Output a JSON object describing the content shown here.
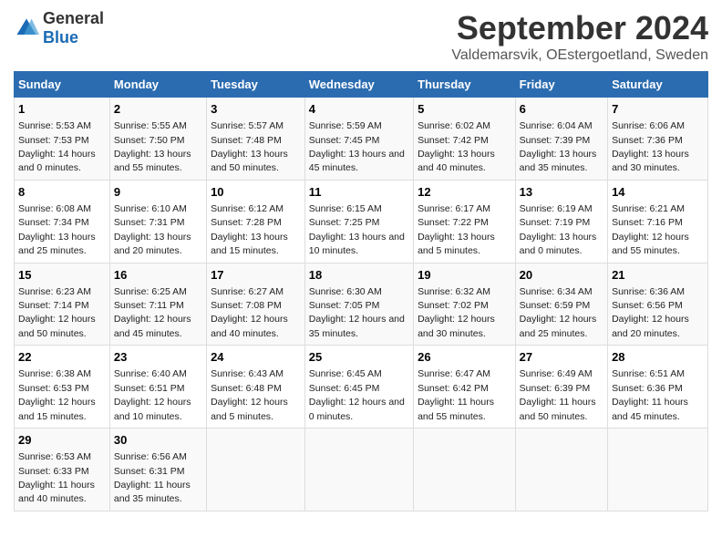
{
  "logo": {
    "general": "General",
    "blue": "Blue"
  },
  "title": "September 2024",
  "subtitle": "Valdemarsvik, OEstergoetland, Sweden",
  "days_header": [
    "Sunday",
    "Monday",
    "Tuesday",
    "Wednesday",
    "Thursday",
    "Friday",
    "Saturday"
  ],
  "weeks": [
    [
      {
        "day": "1",
        "sunrise": "5:53 AM",
        "sunset": "7:53 PM",
        "daylight": "14 hours and 0 minutes."
      },
      {
        "day": "2",
        "sunrise": "5:55 AM",
        "sunset": "7:50 PM",
        "daylight": "13 hours and 55 minutes."
      },
      {
        "day": "3",
        "sunrise": "5:57 AM",
        "sunset": "7:48 PM",
        "daylight": "13 hours and 50 minutes."
      },
      {
        "day": "4",
        "sunrise": "5:59 AM",
        "sunset": "7:45 PM",
        "daylight": "13 hours and 45 minutes."
      },
      {
        "day": "5",
        "sunrise": "6:02 AM",
        "sunset": "7:42 PM",
        "daylight": "13 hours and 40 minutes."
      },
      {
        "day": "6",
        "sunrise": "6:04 AM",
        "sunset": "7:39 PM",
        "daylight": "13 hours and 35 minutes."
      },
      {
        "day": "7",
        "sunrise": "6:06 AM",
        "sunset": "7:36 PM",
        "daylight": "13 hours and 30 minutes."
      }
    ],
    [
      {
        "day": "8",
        "sunrise": "6:08 AM",
        "sunset": "7:34 PM",
        "daylight": "13 hours and 25 minutes."
      },
      {
        "day": "9",
        "sunrise": "6:10 AM",
        "sunset": "7:31 PM",
        "daylight": "13 hours and 20 minutes."
      },
      {
        "day": "10",
        "sunrise": "6:12 AM",
        "sunset": "7:28 PM",
        "daylight": "13 hours and 15 minutes."
      },
      {
        "day": "11",
        "sunrise": "6:15 AM",
        "sunset": "7:25 PM",
        "daylight": "13 hours and 10 minutes."
      },
      {
        "day": "12",
        "sunrise": "6:17 AM",
        "sunset": "7:22 PM",
        "daylight": "13 hours and 5 minutes."
      },
      {
        "day": "13",
        "sunrise": "6:19 AM",
        "sunset": "7:19 PM",
        "daylight": "13 hours and 0 minutes."
      },
      {
        "day": "14",
        "sunrise": "6:21 AM",
        "sunset": "7:16 PM",
        "daylight": "12 hours and 55 minutes."
      }
    ],
    [
      {
        "day": "15",
        "sunrise": "6:23 AM",
        "sunset": "7:14 PM",
        "daylight": "12 hours and 50 minutes."
      },
      {
        "day": "16",
        "sunrise": "6:25 AM",
        "sunset": "7:11 PM",
        "daylight": "12 hours and 45 minutes."
      },
      {
        "day": "17",
        "sunrise": "6:27 AM",
        "sunset": "7:08 PM",
        "daylight": "12 hours and 40 minutes."
      },
      {
        "day": "18",
        "sunrise": "6:30 AM",
        "sunset": "7:05 PM",
        "daylight": "12 hours and 35 minutes."
      },
      {
        "day": "19",
        "sunrise": "6:32 AM",
        "sunset": "7:02 PM",
        "daylight": "12 hours and 30 minutes."
      },
      {
        "day": "20",
        "sunrise": "6:34 AM",
        "sunset": "6:59 PM",
        "daylight": "12 hours and 25 minutes."
      },
      {
        "day": "21",
        "sunrise": "6:36 AM",
        "sunset": "6:56 PM",
        "daylight": "12 hours and 20 minutes."
      }
    ],
    [
      {
        "day": "22",
        "sunrise": "6:38 AM",
        "sunset": "6:53 PM",
        "daylight": "12 hours and 15 minutes."
      },
      {
        "day": "23",
        "sunrise": "6:40 AM",
        "sunset": "6:51 PM",
        "daylight": "12 hours and 10 minutes."
      },
      {
        "day": "24",
        "sunrise": "6:43 AM",
        "sunset": "6:48 PM",
        "daylight": "12 hours and 5 minutes."
      },
      {
        "day": "25",
        "sunrise": "6:45 AM",
        "sunset": "6:45 PM",
        "daylight": "12 hours and 0 minutes."
      },
      {
        "day": "26",
        "sunrise": "6:47 AM",
        "sunset": "6:42 PM",
        "daylight": "11 hours and 55 minutes."
      },
      {
        "day": "27",
        "sunrise": "6:49 AM",
        "sunset": "6:39 PM",
        "daylight": "11 hours and 50 minutes."
      },
      {
        "day": "28",
        "sunrise": "6:51 AM",
        "sunset": "6:36 PM",
        "daylight": "11 hours and 45 minutes."
      }
    ],
    [
      {
        "day": "29",
        "sunrise": "6:53 AM",
        "sunset": "6:33 PM",
        "daylight": "11 hours and 40 minutes."
      },
      {
        "day": "30",
        "sunrise": "6:56 AM",
        "sunset": "6:31 PM",
        "daylight": "11 hours and 35 minutes."
      },
      null,
      null,
      null,
      null,
      null
    ]
  ]
}
